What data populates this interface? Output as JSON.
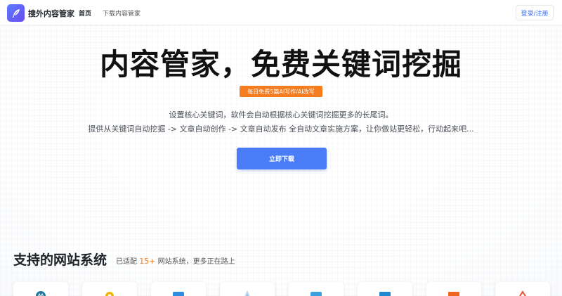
{
  "header": {
    "brand": "搜外内容管家",
    "nav": [
      "首页",
      "下载内容管家"
    ],
    "login": "登录/注册",
    "logo_icon": "feather-icon"
  },
  "hero": {
    "title": "内容管家，免费关键词挖掘",
    "badge": "每日免费5篇AI写作/AI改写",
    "desc_line1": "设置核心关键词，软件会自动根据核心关键词挖掘更多的长尾词。",
    "desc_line2": "提供从关键词自动挖掘 -> 文章自动创作 -> 文章自动发布 全自动文章实施方案，让你做站更轻松，行动起来吧...",
    "cta": "立即下载"
  },
  "systems": {
    "title": "支持的网站系统",
    "sub_prefix": "已适配",
    "count": "15+",
    "sub_suffix": "网站系统，更多正在路上",
    "cards": [
      {
        "icon": "wordpress-icon",
        "color": "#21759b"
      },
      {
        "icon": "dedecms-icon",
        "color": "#f0b400"
      },
      {
        "icon": "zblog-icon",
        "color": "#2f8ddf"
      },
      {
        "icon": "emlog-icon",
        "color": "#7fb5e0"
      },
      {
        "icon": "typecho-icon",
        "color": "#3aa0e0"
      },
      {
        "icon": "empirecms-icon",
        "color": "#1e88d2"
      },
      {
        "icon": "pbootcms-icon",
        "color": "#f06421"
      },
      {
        "icon": "eyoucms-icon",
        "color": "#e8503a"
      }
    ]
  },
  "colors": {
    "accent": "#4a7cf7",
    "badge": "#f57c1f",
    "login_text": "#3b6ef5"
  }
}
